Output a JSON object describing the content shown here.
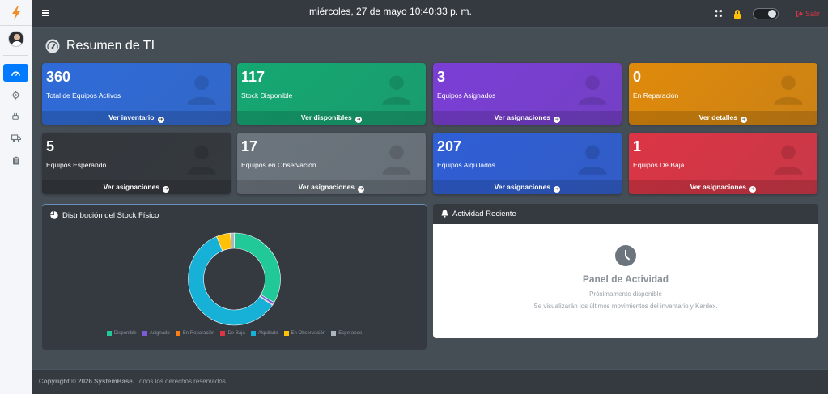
{
  "header": {
    "datetime": "miércoles, 27 de mayo 10:40:33 p. m.",
    "logout_label": "Salir"
  },
  "sidebar": {
    "items": [
      {
        "icon": "dashboard-icon",
        "active": true
      },
      {
        "icon": "gear-icon",
        "active": false
      },
      {
        "icon": "plug-icon",
        "active": false
      },
      {
        "icon": "truck-icon",
        "active": false
      },
      {
        "icon": "clipboard-icon",
        "active": false
      }
    ]
  },
  "page": {
    "title": "Resumen de TI"
  },
  "stats": [
    {
      "value": "360",
      "label": "Total de Equipos Activos",
      "link": "Ver inventario",
      "color": "#2f6bd9"
    },
    {
      "value": "117",
      "label": "Stock Disponible",
      "link": "Ver disponibles",
      "color": "#14a872"
    },
    {
      "value": "3",
      "label": "Equipos Asignados",
      "link": "Ver asignaciones",
      "color": "#7b3ed6"
    },
    {
      "value": "0",
      "label": "En Reparación",
      "link": "Ver detalles",
      "color": "#e08a0b"
    },
    {
      "value": "5",
      "label": "Equipos Esperando",
      "link": "Ver asignaciones",
      "color": "#33373c"
    },
    {
      "value": "17",
      "label": "Equipos en Observación",
      "link": "Ver asignaciones",
      "color": "#6c757d"
    },
    {
      "value": "207",
      "label": "Equipos Alquilados",
      "link": "Ver asignaciones",
      "color": "#2f5fd6"
    },
    {
      "value": "1",
      "label": "Equipos De Baja",
      "link": "Ver asignaciones",
      "color": "#dc3545"
    }
  ],
  "chart_card": {
    "title": "Distribución del Stock Físico"
  },
  "chart_data": {
    "type": "pie",
    "series": [
      {
        "name": "Disponible",
        "value": 117,
        "color": "#20c997"
      },
      {
        "name": "Asignado",
        "value": 3,
        "color": "#7b5cd6"
      },
      {
        "name": "En Reparación",
        "value": 0,
        "color": "#fd7e14"
      },
      {
        "name": "De Baja",
        "value": 1,
        "color": "#dc3545"
      },
      {
        "name": "Alquilado",
        "value": 207,
        "color": "#17b0d6"
      },
      {
        "name": "En Observación",
        "value": 17,
        "color": "#ffc107"
      },
      {
        "name": "Esperando",
        "value": 5,
        "color": "#adb5bd"
      }
    ],
    "legend": "bottom"
  },
  "activity": {
    "title": "Actividad Reciente",
    "panel_title": "Panel de Actividad",
    "subtitle": "Próximamente disponible",
    "description": "Se visualizarán los últimos movimientos del inventario y Kardex."
  },
  "footer": {
    "copyright": "Copyright © 2026 SystemBase.",
    "rights": "Todos los derechos reservados."
  }
}
